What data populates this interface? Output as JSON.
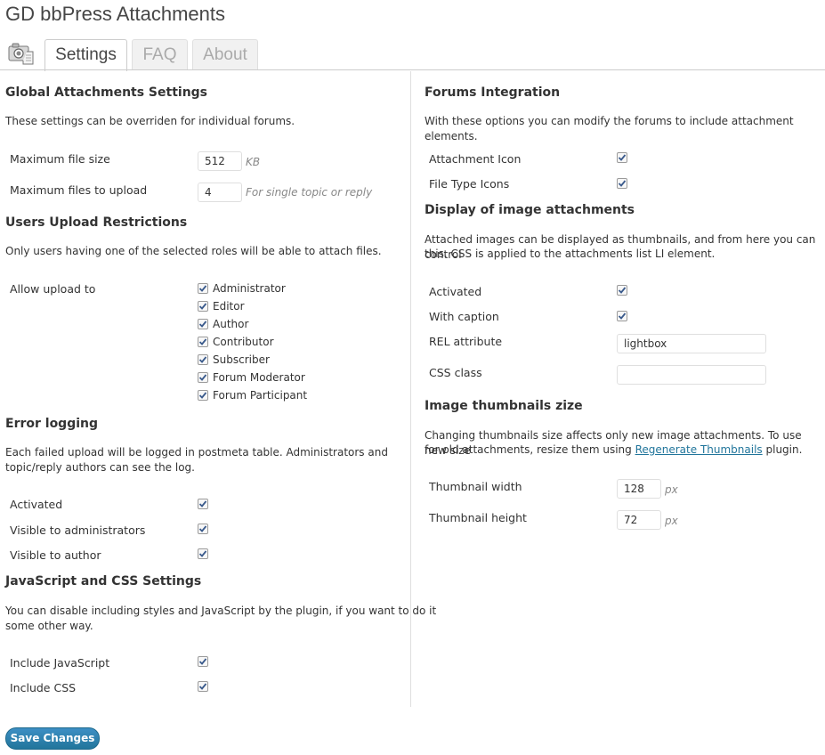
{
  "page_title": "GD bbPress Attachments",
  "tabs": [
    {
      "label": "Settings",
      "active": true
    },
    {
      "label": "FAQ",
      "active": false
    },
    {
      "label": "About",
      "active": false
    }
  ],
  "global": {
    "heading": "Global Attachments Settings",
    "desc": "These settings can be overriden for individual forums.",
    "max_file_size_label": "Maximum file size",
    "max_file_size_value": "512",
    "max_file_size_unit": "KB",
    "max_files_label": "Maximum files to upload",
    "max_files_value": "4",
    "max_files_hint": "For single topic or reply"
  },
  "users": {
    "heading": "Users Upload Restrictions",
    "desc": "Only users having one of the selected roles will be able to attach files.",
    "allow_label": "Allow upload to",
    "roles": [
      "Administrator",
      "Editor",
      "Author",
      "Contributor",
      "Subscriber",
      "Forum Moderator",
      "Forum Participant"
    ]
  },
  "error": {
    "heading": "Error logging",
    "desc_line1": "Each failed upload will be logged in postmeta table. Administrators and",
    "desc_line2": "topic/reply authors can see the log.",
    "activated": "Activated",
    "visible_admins": "Visible to administrators",
    "visible_author": "Visible to author"
  },
  "jscss": {
    "heading": "JavaScript and CSS Settings",
    "desc_line1": "You can disable including styles and JavaScript by the plugin, if you want to do it",
    "desc_line2": "some other way.",
    "include_js": "Include JavaScript",
    "include_css": "Include CSS"
  },
  "forums": {
    "heading": "Forums Integration",
    "desc": "With these options you can modify the forums to include attachment elements.",
    "attachment_icon": "Attachment Icon",
    "file_type_icons": "File Type Icons"
  },
  "display": {
    "heading": "Display of image attachments",
    "desc_line1": "Attached images can be displayed as thumbnails, and from here you can control",
    "desc_line2": "this. CSS is applied to the attachments list LI element.",
    "activated": "Activated",
    "with_caption": "With caption",
    "rel_label": "REL attribute",
    "rel_value": "lightbox",
    "css_label": "CSS class",
    "css_value": ""
  },
  "thumbs": {
    "heading": "Image thumbnails zize",
    "desc_line1": "Changing thumbnails size affects only new image attachments. To use new size",
    "desc_line2_pre": "for old attachments, resize them using ",
    "desc_link": "Regenerate Thumbnails",
    "desc_line2_post": " plugin.",
    "width_label": "Thumbnail width",
    "width_value": "128",
    "height_label": "Thumbnail height",
    "height_value": "72",
    "unit": "px"
  },
  "save_label": "Save Changes",
  "icons": {
    "page": "camera-attachment-icon",
    "check": "checkmark-icon"
  }
}
